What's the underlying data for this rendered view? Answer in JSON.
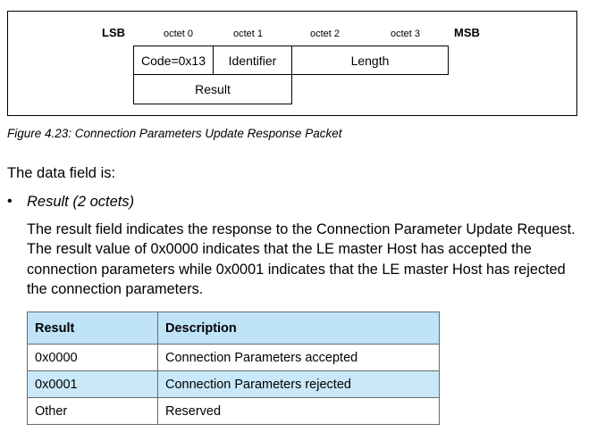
{
  "figure": {
    "lsb": "LSB",
    "msb": "MSB",
    "octets": [
      "octet 0",
      "octet 1",
      "octet 2",
      "octet 3"
    ],
    "fields": {
      "code": "Code=0x13",
      "identifier": "Identifier",
      "length": "Length",
      "result": "Result"
    },
    "caption": "Figure 4.23:  Connection Parameters Update Response Packet"
  },
  "text": {
    "data_field_intro": "The data field is:",
    "bullet": "•",
    "bullet_heading": "Result (2 octets)",
    "paragraph": "The result field indicates the response to the Connection Parameter Update Request. The result value of 0x0000 indicates that the LE master Host has accepted the connection parameters while 0x0001 indicates that the LE master Host has rejected the connection parameters."
  },
  "table": {
    "headers": [
      "Result",
      "Description"
    ],
    "rows": [
      [
        "0x0000",
        "Connection Parameters accepted"
      ],
      [
        "0x0001",
        "Connection Parameters rejected"
      ],
      [
        "Other",
        "Reserved"
      ]
    ]
  }
}
